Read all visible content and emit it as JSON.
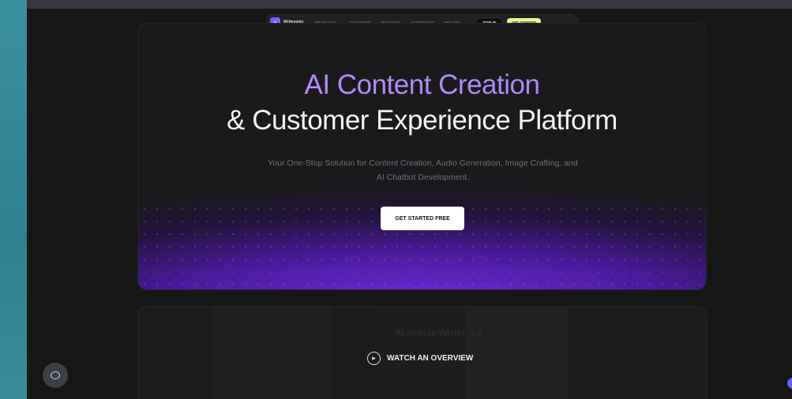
{
  "navbar": {
    "brand": "Writesonic",
    "items": [
      {
        "label": "PRODUCTS",
        "has_chevron": true
      },
      {
        "label": "CHATSONIC",
        "has_chevron": false
      },
      {
        "label": "BOTSONIC",
        "has_chevron": false
      },
      {
        "label": "AUDIOSONIC",
        "has_chevron": false
      },
      {
        "label": "PRICING",
        "has_chevron": true
      }
    ],
    "chevron": "⌄",
    "sign_in": "SIGN IN",
    "get_started": "GET STARTED"
  },
  "hero": {
    "title_line1": "AI Content Creation",
    "title_line2": "& Customer Experience Platform",
    "subtitle": "Your One-Stop Solution for Content Creation, Audio Generation, Image Crafting, and AI Chatbot Development.",
    "cta": "GET STARTED FREE"
  },
  "video": {
    "label": "WATCH AN OVERVIEW",
    "background_text": "AI Article Writer 5.0"
  },
  "colors": {
    "accent": "#6b2bd9",
    "cta_background": "#ffffff",
    "get_started_background": "#e6ff94"
  }
}
